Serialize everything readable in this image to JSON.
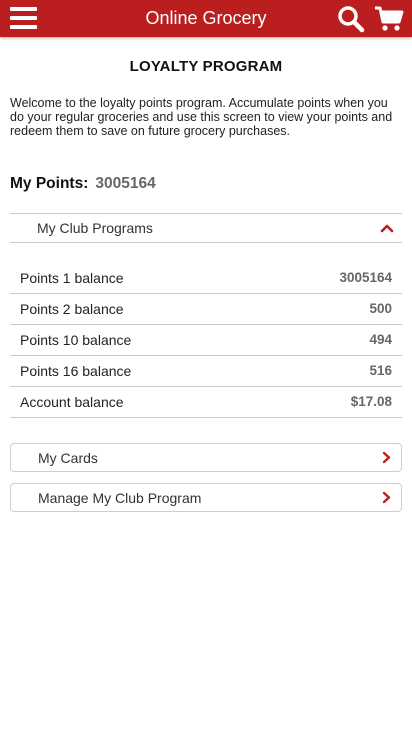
{
  "header": {
    "title": "Online Grocery",
    "menu_icon": "hamburger-menu-icon",
    "search_icon": "search-icon",
    "cart_icon": "shopping-cart-icon",
    "brand_color": "#bb1e1e"
  },
  "page": {
    "title": "LOYALTY PROGRAM",
    "intro": "Welcome to the loyalty points program. Accumulate points when you do your regular groceries and use this screen to view your points and redeem them to save on future grocery purchases."
  },
  "points": {
    "label": "My Points:",
    "value": "3005164"
  },
  "club_programs": {
    "label": "My Club Programs",
    "expanded": true,
    "rows": [
      {
        "label": "Points 1 balance",
        "value": "3005164"
      },
      {
        "label": "Points 2 balance",
        "value": "500"
      },
      {
        "label": "Points 10 balance",
        "value": "494"
      },
      {
        "label": "Points 16 balance",
        "value": "516"
      },
      {
        "label": "Account balance",
        "value": "$17.08"
      }
    ]
  },
  "links": [
    {
      "label": "My Cards"
    },
    {
      "label": "Manage My Club Program"
    }
  ]
}
